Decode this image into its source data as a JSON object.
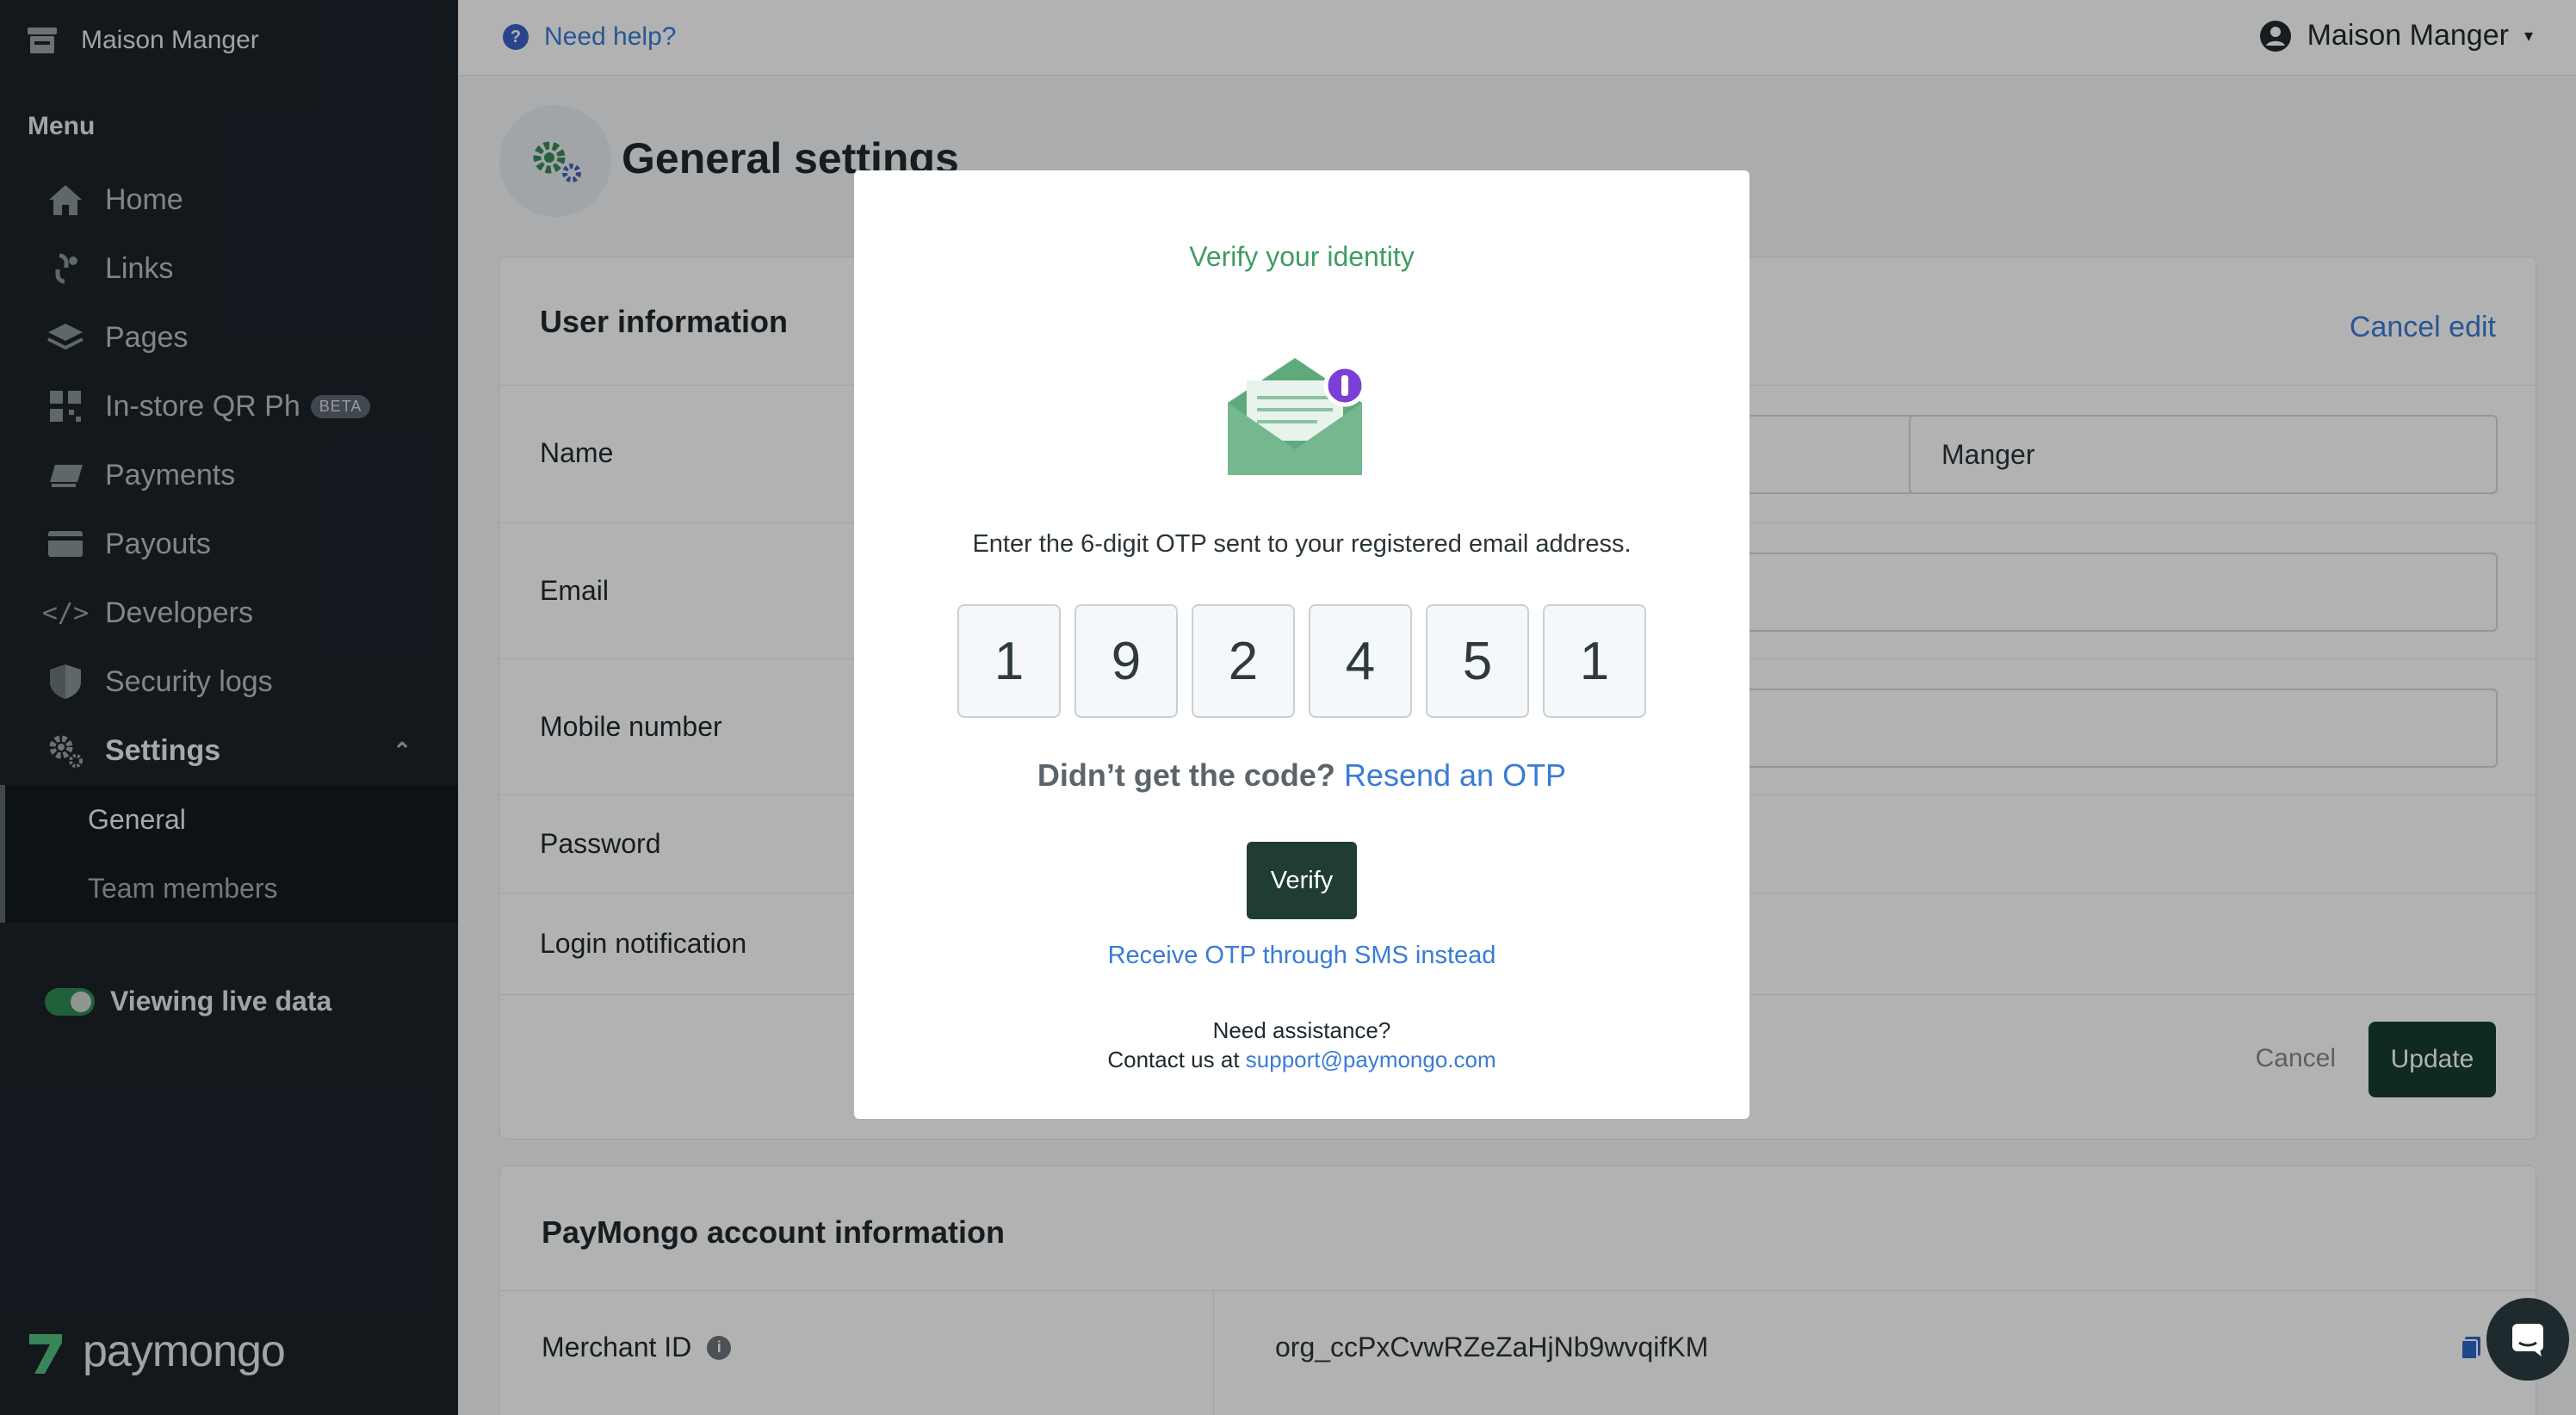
{
  "sidebar": {
    "store_name": "Maison Manger",
    "menu_title": "Menu",
    "items": [
      {
        "label": "Home"
      },
      {
        "label": "Links"
      },
      {
        "label": "Pages"
      },
      {
        "label": "In-store QR Ph",
        "badge": "BETA"
      },
      {
        "label": "Payments"
      },
      {
        "label": "Payouts"
      },
      {
        "label": "Developers"
      },
      {
        "label": "Security logs"
      },
      {
        "label": "Settings"
      }
    ],
    "settings_sub": [
      {
        "label": "General"
      },
      {
        "label": "Team members"
      }
    ],
    "live_label": "Viewing live data",
    "logo_text": "paymongo",
    "accent": "#2e8b57"
  },
  "topbar": {
    "help_label": "Need help?",
    "user_name": "Maison Manger"
  },
  "page": {
    "title": "General settings"
  },
  "user_info": {
    "heading": "User information",
    "cancel_edit": "Cancel edit",
    "rows": {
      "name": "Name",
      "email": "Email",
      "mobile": "Mobile number",
      "password": "Password",
      "login_notification": "Login notification"
    },
    "last_name_value": "Manger",
    "cancel_label": "Cancel",
    "update_label": "Update"
  },
  "account_info": {
    "heading": "PayMongo account information",
    "merchant_label": "Merchant ID",
    "merchant_id": "org_ccPxCvwRZeZaHjNb9wvqifKM"
  },
  "modal": {
    "title": "Verify your identity",
    "instruction": "Enter the 6-digit OTP sent to your registered email address.",
    "otp_digits": [
      "1",
      "9",
      "2",
      "4",
      "5",
      "1"
    ],
    "resend_prompt": "Didn’t get the code?",
    "resend_link": "Resend an OTP",
    "verify_label": "Verify",
    "sms_link": "Receive OTP through SMS instead",
    "assist_line": "Need assistance?",
    "contact_prefix": "Contact us at",
    "contact_email": "support@paymongo.com"
  }
}
